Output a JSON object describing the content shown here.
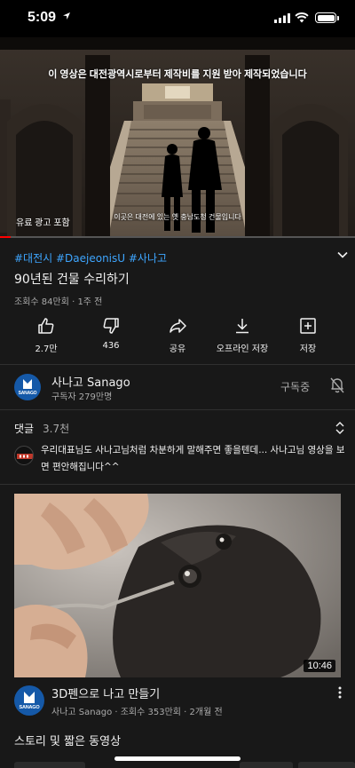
{
  "status_bar": {
    "time": "5:09"
  },
  "player": {
    "subtitle": "이 영상은 대전광역시로부터 제작비를 지원 받아 제작되었습니다",
    "caption": "이곳은 대전에 있는 옛 충남도청 건물입니다",
    "promo_tag": "유료 광고 포함",
    "progress": 0.03,
    "accent_color": "#ff0000"
  },
  "video": {
    "hashtags": "#대전시 #DaejeonisU #사나고",
    "title": "90년된 건물 수리하기",
    "meta": "조회수 84만회 · 1주 전"
  },
  "actions": [
    {
      "icon": "thumbs-up-icon",
      "label": "2.7만"
    },
    {
      "icon": "thumbs-down-icon",
      "label": "436"
    },
    {
      "icon": "share-icon",
      "label": "공유"
    },
    {
      "icon": "download-icon",
      "label": "오프라인 저장"
    },
    {
      "icon": "add-to-playlist-icon",
      "label": "저장"
    }
  ],
  "channel": {
    "name": "사나고 Sanago",
    "subscribers": "구독자 279만명",
    "subscribed_label": "구독중",
    "logo_text": "SANAGO",
    "brand_color": "#1559a8"
  },
  "comments": {
    "label": "댓글",
    "count": "3.7천",
    "top_comment": "우리대표님도 사나고님처럼 차분하게 말해주면 좋을텐데... 사나고님 영상을 보면 편안해집니다^^"
  },
  "next_video": {
    "duration": "10:46",
    "title": "3D펜으로 나고 만들기",
    "meta": "사나고 Sanago · 조회수 353만회 · 2개월 전"
  },
  "section": {
    "title": "스토리 및 짧은 동영상"
  }
}
